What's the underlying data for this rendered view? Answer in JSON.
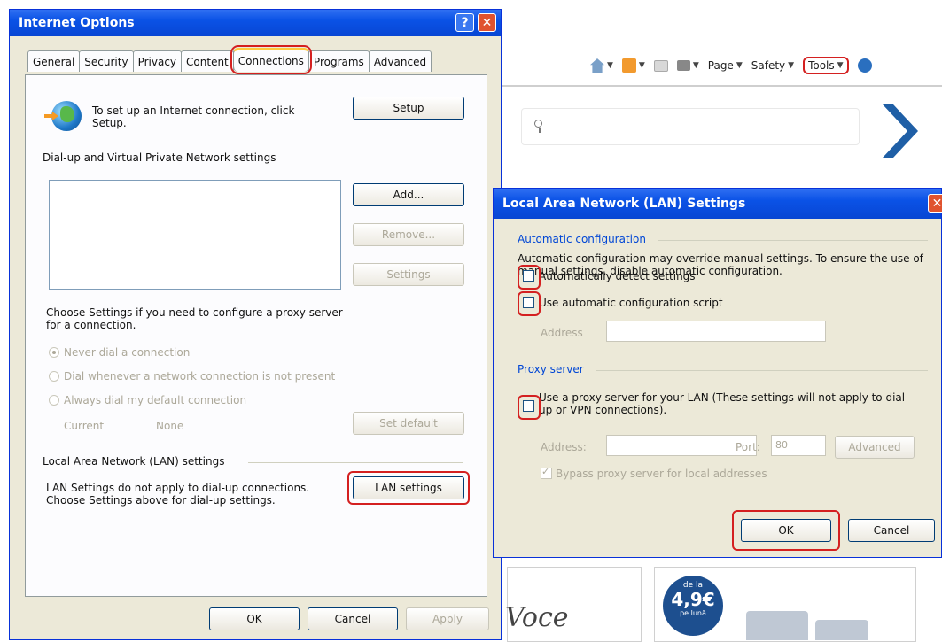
{
  "browser": {
    "toolbar": {
      "page_label": "Page",
      "safety_label": "Safety",
      "tools_label": "Tools"
    },
    "promo": {
      "top": "de la",
      "price": "4,9€",
      "bottom": "pe lună"
    },
    "logo_text": "Voce"
  },
  "internet_options": {
    "title": "Internet Options",
    "help": "?",
    "close": "✕",
    "tabs": [
      {
        "label": "General"
      },
      {
        "label": "Security"
      },
      {
        "label": "Privacy"
      },
      {
        "label": "Content"
      },
      {
        "label": "Connections"
      },
      {
        "label": "Programs"
      },
      {
        "label": "Advanced"
      }
    ],
    "active_tab": "Connections",
    "setup_text": "To set up an Internet connection, click Setup.",
    "setup_button": "Setup",
    "dialup_group": "Dial-up and Virtual Private Network settings",
    "add_button": "Add...",
    "remove_button": "Remove...",
    "settings_button": "Settings",
    "proxy_hint": "Choose Settings if you need to configure a proxy server for a connection.",
    "radio_never": "Never dial a connection",
    "radio_whenever": "Dial whenever a network connection is not present",
    "radio_always": "Always dial my default connection",
    "current_label": "Current",
    "current_value": "None",
    "set_default_button": "Set default",
    "lan_group": "Local Area Network (LAN) settings",
    "lan_text": "LAN Settings do not apply to dial-up connections. Choose Settings above for dial-up settings.",
    "lan_button": "LAN settings",
    "ok_button": "OK",
    "cancel_button": "Cancel",
    "apply_button": "Apply"
  },
  "lan_dialog": {
    "title": "Local Area Network (LAN) Settings",
    "close": "✕",
    "auto_group": "Automatic configuration",
    "auto_desc": "Automatic configuration may override manual settings.  To ensure the use of manual settings, disable automatic configuration.",
    "auto_detect_label": "Automatically detect settings",
    "auto_script_label": "Use automatic configuration script",
    "address_label": "Address",
    "proxy_group": "Proxy server",
    "proxy_label": "Use a proxy server for your LAN (These settings will not apply to dial-up or VPN connections).",
    "proxy_address_label": "Address:",
    "port_label": "Port:",
    "port_value": "80",
    "advanced_button": "Advanced",
    "bypass_label": "Bypass proxy server for local addresses",
    "ok_button": "OK",
    "cancel_button": "Cancel"
  },
  "colors": {
    "dialog_face": "#ece9d8",
    "titlebar_blue": "#0a52e6",
    "highlight_red": "#d42020",
    "disabled_text": "#aca899"
  }
}
